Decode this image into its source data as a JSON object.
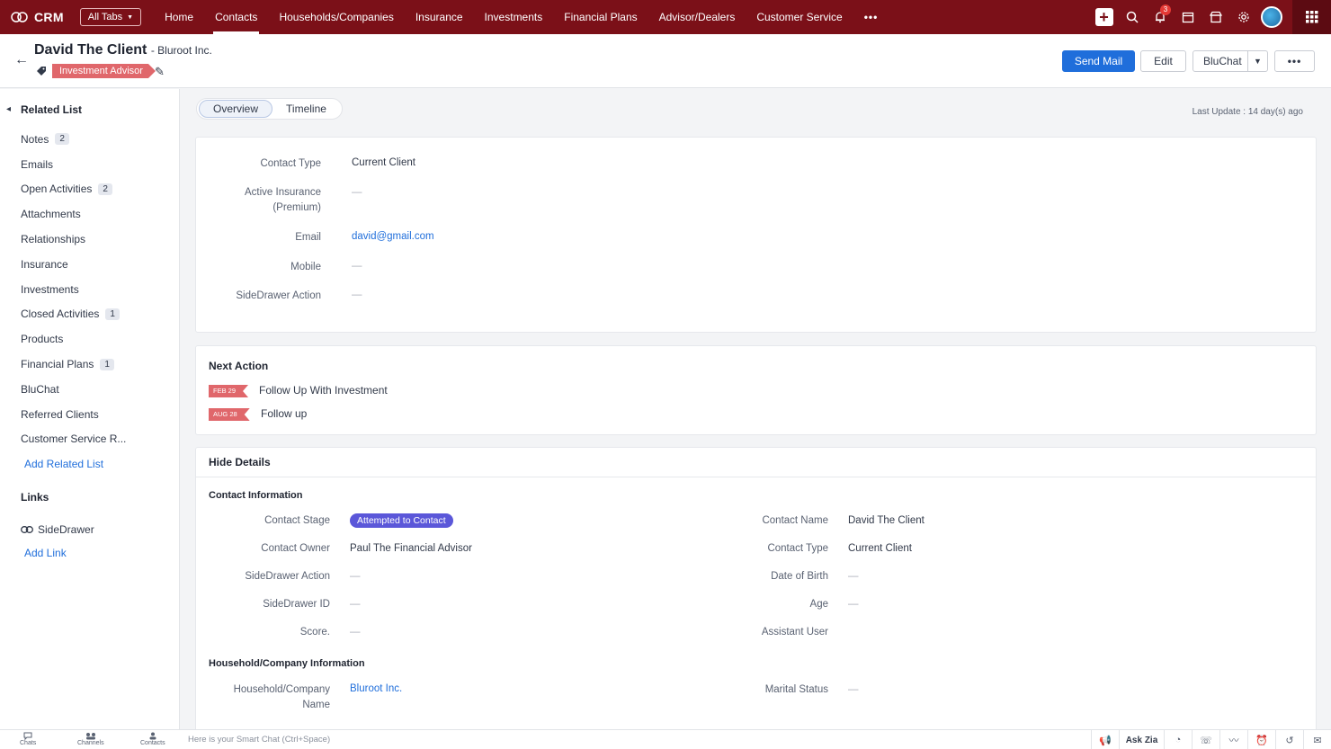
{
  "topbar": {
    "brand": "CRM",
    "all_tabs": "All Tabs",
    "nav": [
      "Home",
      "Contacts",
      "Households/Companies",
      "Insurance",
      "Investments",
      "Financial Plans",
      "Advisor/Dealers",
      "Customer Service"
    ],
    "active_nav": "Contacts",
    "more": "•••",
    "notifications_count": "3"
  },
  "header": {
    "name": "David The Client",
    "company": "- Bluroot Inc.",
    "tag": "Investment Advisor",
    "send_mail": "Send Mail",
    "edit": "Edit",
    "bluchat": "BluChat",
    "more": "•••"
  },
  "sidebar": {
    "title": "Related List",
    "items": [
      {
        "label": "Notes",
        "count": "2"
      },
      {
        "label": "Emails",
        "count": ""
      },
      {
        "label": "Open Activities",
        "count": "2"
      },
      {
        "label": "Attachments",
        "count": ""
      },
      {
        "label": "Relationships",
        "count": ""
      },
      {
        "label": "Insurance",
        "count": ""
      },
      {
        "label": "Investments",
        "count": ""
      },
      {
        "label": "Closed Activities",
        "count": "1"
      },
      {
        "label": "Products",
        "count": ""
      },
      {
        "label": "Financial Plans",
        "count": "1"
      },
      {
        "label": "BluChat",
        "count": ""
      },
      {
        "label": "Referred Clients",
        "count": ""
      },
      {
        "label": "Customer Service R...",
        "count": ""
      }
    ],
    "add_related": "Add Related List",
    "links_title": "Links",
    "sidedrawer": "SideDrawer",
    "add_link": "Add Link"
  },
  "tabs": {
    "overview": "Overview",
    "timeline": "Timeline"
  },
  "last_update": "Last Update : 14 day(s) ago",
  "overview": {
    "contact_type_label": "Contact Type",
    "contact_type": "Current Client",
    "active_insurance_label_1": "Active Insurance",
    "active_insurance_label_2": "(Premium)",
    "active_insurance": "—",
    "email_label": "Email",
    "email": "david@gmail.com",
    "mobile_label": "Mobile",
    "mobile": "—",
    "sidedrawer_action_label": "SideDrawer Action",
    "sidedrawer_action": "—"
  },
  "next_action": {
    "title": "Next Action",
    "items": [
      {
        "date": "FEB 29",
        "text": "Follow Up With Investment"
      },
      {
        "date": "AUG 28",
        "text": "Follow up"
      }
    ]
  },
  "details": {
    "hide": "Hide Details",
    "contact_info": "Contact Information",
    "left": [
      {
        "label": "Contact Stage",
        "value": "Attempted to Contact"
      },
      {
        "label": "Contact Owner",
        "value": "Paul The Financial Advisor"
      },
      {
        "label": "SideDrawer Action",
        "value": "—"
      },
      {
        "label": "SideDrawer ID",
        "value": "—"
      },
      {
        "label": "Score.",
        "value": "—"
      }
    ],
    "right": [
      {
        "label": "Contact Name",
        "value": "David The Client"
      },
      {
        "label": "Contact Type",
        "value": "Current Client"
      },
      {
        "label": "Date of Birth",
        "value": "—"
      },
      {
        "label": "Age",
        "value": "—"
      },
      {
        "label": "Assistant User",
        "value": ""
      }
    ],
    "household_info": "Household/Company Information",
    "household_label_1": "Household/Company",
    "household_label_2": "Name",
    "household_value": "Bluroot Inc.",
    "marital_label": "Marital Status",
    "marital_value": "—"
  },
  "bottombar": {
    "chats": "Chats",
    "channels": "Channels",
    "contacts": "Contacts",
    "smartchat_placeholder": "Here is your Smart Chat (Ctrl+Space)",
    "ask_zia": "Ask Zia"
  },
  "colors": {
    "topbar": "#7b1018",
    "primary": "#1f6edb",
    "tag": "#e0676b",
    "stage": "#5b57d9"
  }
}
